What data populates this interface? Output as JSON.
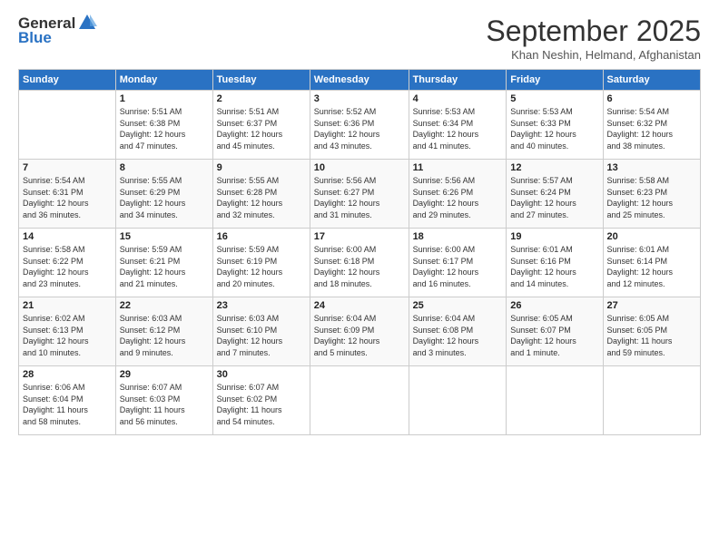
{
  "header": {
    "logo_general": "General",
    "logo_blue": "Blue",
    "title": "September 2025",
    "location": "Khan Neshin, Helmand, Afghanistan"
  },
  "weekdays": [
    "Sunday",
    "Monday",
    "Tuesday",
    "Wednesday",
    "Thursday",
    "Friday",
    "Saturday"
  ],
  "weeks": [
    [
      {
        "day": "",
        "info": ""
      },
      {
        "day": "1",
        "info": "Sunrise: 5:51 AM\nSunset: 6:38 PM\nDaylight: 12 hours\nand 47 minutes."
      },
      {
        "day": "2",
        "info": "Sunrise: 5:51 AM\nSunset: 6:37 PM\nDaylight: 12 hours\nand 45 minutes."
      },
      {
        "day": "3",
        "info": "Sunrise: 5:52 AM\nSunset: 6:36 PM\nDaylight: 12 hours\nand 43 minutes."
      },
      {
        "day": "4",
        "info": "Sunrise: 5:53 AM\nSunset: 6:34 PM\nDaylight: 12 hours\nand 41 minutes."
      },
      {
        "day": "5",
        "info": "Sunrise: 5:53 AM\nSunset: 6:33 PM\nDaylight: 12 hours\nand 40 minutes."
      },
      {
        "day": "6",
        "info": "Sunrise: 5:54 AM\nSunset: 6:32 PM\nDaylight: 12 hours\nand 38 minutes."
      }
    ],
    [
      {
        "day": "7",
        "info": "Sunrise: 5:54 AM\nSunset: 6:31 PM\nDaylight: 12 hours\nand 36 minutes."
      },
      {
        "day": "8",
        "info": "Sunrise: 5:55 AM\nSunset: 6:29 PM\nDaylight: 12 hours\nand 34 minutes."
      },
      {
        "day": "9",
        "info": "Sunrise: 5:55 AM\nSunset: 6:28 PM\nDaylight: 12 hours\nand 32 minutes."
      },
      {
        "day": "10",
        "info": "Sunrise: 5:56 AM\nSunset: 6:27 PM\nDaylight: 12 hours\nand 31 minutes."
      },
      {
        "day": "11",
        "info": "Sunrise: 5:56 AM\nSunset: 6:26 PM\nDaylight: 12 hours\nand 29 minutes."
      },
      {
        "day": "12",
        "info": "Sunrise: 5:57 AM\nSunset: 6:24 PM\nDaylight: 12 hours\nand 27 minutes."
      },
      {
        "day": "13",
        "info": "Sunrise: 5:58 AM\nSunset: 6:23 PM\nDaylight: 12 hours\nand 25 minutes."
      }
    ],
    [
      {
        "day": "14",
        "info": "Sunrise: 5:58 AM\nSunset: 6:22 PM\nDaylight: 12 hours\nand 23 minutes."
      },
      {
        "day": "15",
        "info": "Sunrise: 5:59 AM\nSunset: 6:21 PM\nDaylight: 12 hours\nand 21 minutes."
      },
      {
        "day": "16",
        "info": "Sunrise: 5:59 AM\nSunset: 6:19 PM\nDaylight: 12 hours\nand 20 minutes."
      },
      {
        "day": "17",
        "info": "Sunrise: 6:00 AM\nSunset: 6:18 PM\nDaylight: 12 hours\nand 18 minutes."
      },
      {
        "day": "18",
        "info": "Sunrise: 6:00 AM\nSunset: 6:17 PM\nDaylight: 12 hours\nand 16 minutes."
      },
      {
        "day": "19",
        "info": "Sunrise: 6:01 AM\nSunset: 6:16 PM\nDaylight: 12 hours\nand 14 minutes."
      },
      {
        "day": "20",
        "info": "Sunrise: 6:01 AM\nSunset: 6:14 PM\nDaylight: 12 hours\nand 12 minutes."
      }
    ],
    [
      {
        "day": "21",
        "info": "Sunrise: 6:02 AM\nSunset: 6:13 PM\nDaylight: 12 hours\nand 10 minutes."
      },
      {
        "day": "22",
        "info": "Sunrise: 6:03 AM\nSunset: 6:12 PM\nDaylight: 12 hours\nand 9 minutes."
      },
      {
        "day": "23",
        "info": "Sunrise: 6:03 AM\nSunset: 6:10 PM\nDaylight: 12 hours\nand 7 minutes."
      },
      {
        "day": "24",
        "info": "Sunrise: 6:04 AM\nSunset: 6:09 PM\nDaylight: 12 hours\nand 5 minutes."
      },
      {
        "day": "25",
        "info": "Sunrise: 6:04 AM\nSunset: 6:08 PM\nDaylight: 12 hours\nand 3 minutes."
      },
      {
        "day": "26",
        "info": "Sunrise: 6:05 AM\nSunset: 6:07 PM\nDaylight: 12 hours\nand 1 minute."
      },
      {
        "day": "27",
        "info": "Sunrise: 6:05 AM\nSunset: 6:05 PM\nDaylight: 11 hours\nand 59 minutes."
      }
    ],
    [
      {
        "day": "28",
        "info": "Sunrise: 6:06 AM\nSunset: 6:04 PM\nDaylight: 11 hours\nand 58 minutes."
      },
      {
        "day": "29",
        "info": "Sunrise: 6:07 AM\nSunset: 6:03 PM\nDaylight: 11 hours\nand 56 minutes."
      },
      {
        "day": "30",
        "info": "Sunrise: 6:07 AM\nSunset: 6:02 PM\nDaylight: 11 hours\nand 54 minutes."
      },
      {
        "day": "",
        "info": ""
      },
      {
        "day": "",
        "info": ""
      },
      {
        "day": "",
        "info": ""
      },
      {
        "day": "",
        "info": ""
      }
    ]
  ]
}
